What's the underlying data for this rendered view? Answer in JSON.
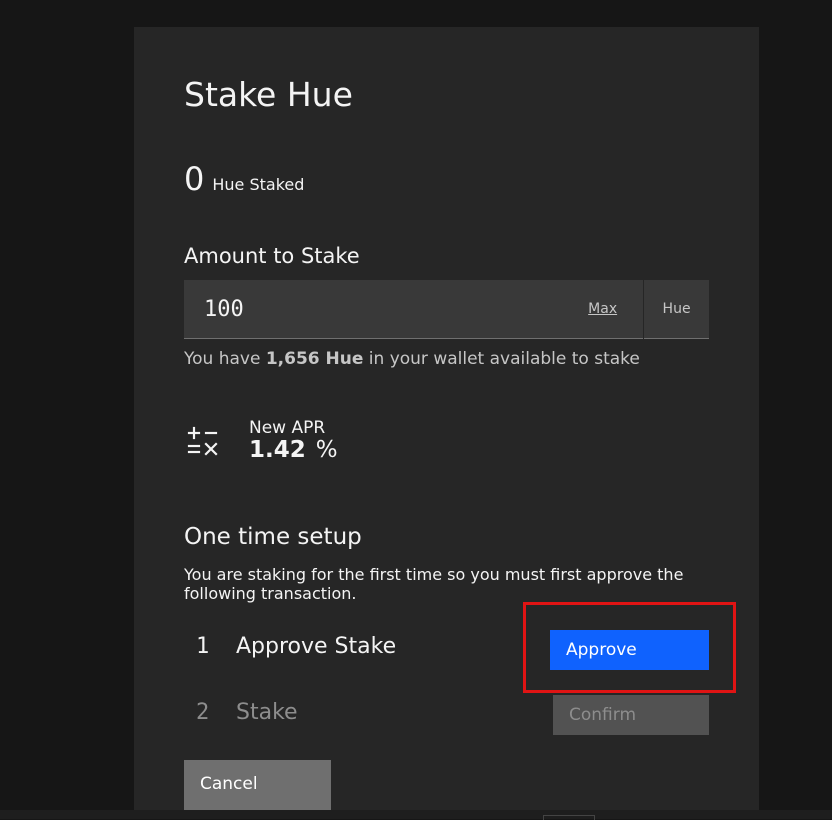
{
  "modal": {
    "title": "Stake Hue",
    "staked_amount": "0",
    "staked_label": "Hue Staked",
    "amount_label": "Amount to Stake",
    "amount_value": "100",
    "max_label": "Max",
    "unit_label": "Hue",
    "wallet_note_prefix": "You have ",
    "wallet_balance": "1,656 Hue",
    "wallet_note_suffix": " in your wallet available to stake",
    "apr_icon": "calculator-icon",
    "apr_label": "New APR",
    "apr_value": "1.42",
    "apr_unit": "%",
    "setup_title": "One time setup",
    "setup_description": "You are staking for the first time so you must first approve the following transaction.",
    "steps": [
      {
        "number": "1",
        "label": "Approve Stake",
        "button": "Approve",
        "state": "active"
      },
      {
        "number": "2",
        "label": "Stake",
        "button": "Confirm",
        "state": "disabled"
      }
    ],
    "cancel_label": "Cancel"
  },
  "colors": {
    "background": "#161616",
    "panel": "#262626",
    "field": "#393939",
    "primary": "#0f62fe",
    "disabled_button": "#525252",
    "cancel_button": "#6f6f6f",
    "highlight": "#e01414"
  }
}
